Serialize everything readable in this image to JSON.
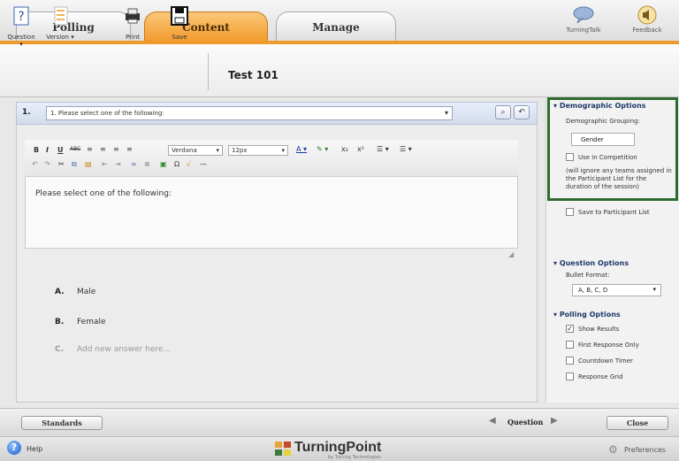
{
  "tabs": [
    "Polling",
    "Content",
    "Manage"
  ],
  "top_icons": [
    {
      "label": "TurningTalk",
      "icon": "speech-bubble-icon"
    },
    {
      "label": "Feedback",
      "icon": "speaker-icon"
    }
  ],
  "toolbar": {
    "question_label": "Question",
    "version_label": "Version",
    "print_label": "Print",
    "save_label": "Save",
    "title": "Test 101"
  },
  "question": {
    "number": "1.",
    "selected": "1. Please select one of the following:",
    "body_text": "Please select one of the following:"
  },
  "editor": {
    "font": "Verdana",
    "size": "12px"
  },
  "answers": [
    {
      "letter": "A.",
      "text": "Male"
    },
    {
      "letter": "B.",
      "text": "Female"
    },
    {
      "letter": "C.",
      "text": "Add new answer here..."
    }
  ],
  "right": {
    "demographic_header": "Demographic Options",
    "demographic_grouping_label": "Demographic Grouping:",
    "grouping_value": "Gender",
    "use_in_competition": "Use in Competition",
    "competition_note": "(will ignore any teams assigned in the Participant List for the duration of the session)",
    "save_to_participant": "Save to Participant List",
    "question_options_header": "Question Options",
    "bullet_format_label": "Bullet Format:",
    "bullet_format_value": "A, B, C, D",
    "polling_options_header": "Polling Options",
    "polling_options": [
      {
        "label": "Show Results",
        "checked": true
      },
      {
        "label": "First Response Only",
        "checked": false
      },
      {
        "label": "Countdown Timer",
        "checked": false
      },
      {
        "label": "Response Grid",
        "checked": false
      }
    ]
  },
  "bottom": {
    "standards_label": "Standards",
    "question_nav_label": "Question",
    "close_label": "Close"
  },
  "status": {
    "help_label": "Help",
    "logo_text": "TurningPoint",
    "logo_sub": "by Turning Technologies",
    "preferences_label": "Preferences"
  }
}
